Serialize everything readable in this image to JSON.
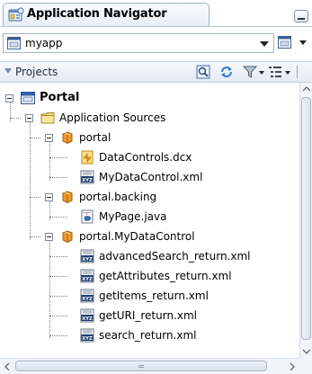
{
  "window": {
    "title": "Application Navigator",
    "minimize_icon": "minimize-icon"
  },
  "application": {
    "selected": "myapp",
    "icon": "application-icon"
  },
  "projects_bar": {
    "label": "Projects",
    "tools": [
      "navigator-icon",
      "refresh-icon",
      "filter-icon",
      "sort-icon"
    ]
  },
  "tree": [
    {
      "label": "Portal",
      "icon": "project-icon",
      "level": 0,
      "expanded": true,
      "bold": true
    },
    {
      "label": "Application Sources",
      "icon": "folder-icon",
      "level": 1,
      "expanded": true
    },
    {
      "label": "portal",
      "icon": "package-icon",
      "level": 2,
      "expanded": true
    },
    {
      "label": "DataControls.dcx",
      "icon": "dcx-file-icon",
      "level": 3
    },
    {
      "label": "MyDataControl.xml",
      "icon": "xml-file-icon",
      "level": 3
    },
    {
      "label": "portal.backing",
      "icon": "package-icon",
      "level": 2,
      "expanded": true
    },
    {
      "label": "MyPage.java",
      "icon": "java-file-icon",
      "level": 3
    },
    {
      "label": "portal.MyDataControl",
      "icon": "package-icon",
      "level": 2,
      "expanded": true
    },
    {
      "label": "advancedSearch_return.xml",
      "icon": "xml-file-icon",
      "level": 3
    },
    {
      "label": "getAttributes_return.xml",
      "icon": "xml-file-icon",
      "level": 3
    },
    {
      "label": "getItems_return.xml",
      "icon": "xml-file-icon",
      "level": 3
    },
    {
      "label": "getURI_return.xml",
      "icon": "xml-file-icon",
      "level": 3
    },
    {
      "label": "search_return.xml",
      "icon": "xml-file-icon",
      "level": 3
    }
  ]
}
